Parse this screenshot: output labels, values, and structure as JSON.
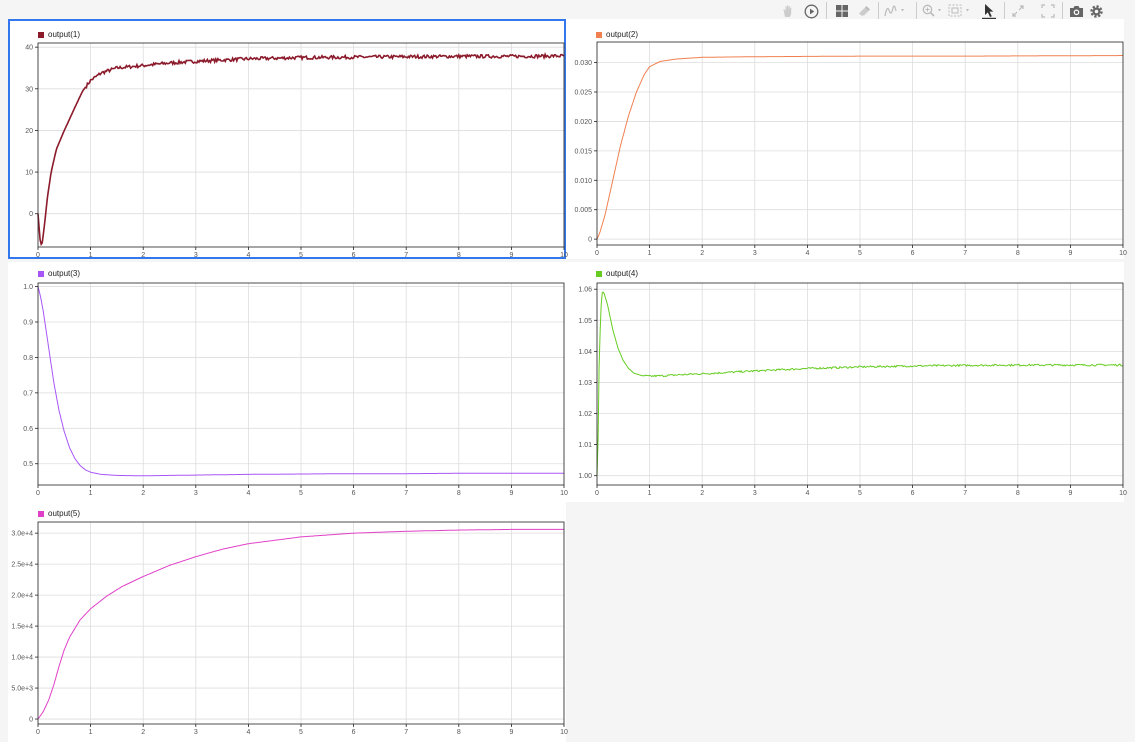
{
  "toolbar": {
    "icons": [
      {
        "name": "pan-hand-icon",
        "enabled": false
      },
      {
        "name": "play-circle-icon",
        "enabled": true
      },
      {
        "name": "layout-grid-icon",
        "enabled": true
      },
      {
        "name": "eraser-icon",
        "enabled": false
      },
      {
        "name": "signal-cursor-icon",
        "enabled": false
      },
      {
        "name": "zoom-in-icon",
        "enabled": false
      },
      {
        "name": "zoom-box-icon",
        "enabled": false
      },
      {
        "name": "pointer-select-icon",
        "enabled": true
      },
      {
        "name": "expand-arrows-icon",
        "enabled": false
      },
      {
        "name": "fullscreen-icon",
        "enabled": false
      },
      {
        "name": "camera-icon",
        "enabled": true
      },
      {
        "name": "gear-icon",
        "enabled": true
      }
    ]
  },
  "colors": {
    "selection_border": "#3377ee",
    "grid": "#dddddd",
    "axis_frame": "#222222"
  },
  "chart_data": [
    {
      "type": "line",
      "title": "",
      "selected": true,
      "series": [
        {
          "name": "output(1)",
          "color": "#8b1a2b",
          "noise": 0.4,
          "points": [
            [
              0,
              0
            ],
            [
              0.03,
              -5
            ],
            [
              0.05,
              -7.5
            ],
            [
              0.08,
              -7
            ],
            [
              0.12,
              -3
            ],
            [
              0.18,
              4
            ],
            [
              0.25,
              10
            ],
            [
              0.35,
              15.5
            ],
            [
              0.5,
              20
            ],
            [
              0.7,
              25.5
            ],
            [
              0.85,
              29.5
            ],
            [
              1.0,
              32
            ],
            [
              1.2,
              33.8
            ],
            [
              1.5,
              35
            ],
            [
              2,
              35.6
            ],
            [
              2.5,
              36.2
            ],
            [
              3,
              36.6
            ],
            [
              4,
              37.2
            ],
            [
              5,
              37.5
            ],
            [
              6,
              37.6
            ],
            [
              7,
              37.7
            ],
            [
              8,
              37.8
            ],
            [
              9,
              37.8
            ],
            [
              10,
              37.9
            ]
          ]
        }
      ],
      "x_ticks": [
        "0",
        "1",
        "2",
        "3",
        "4",
        "5",
        "6",
        "7",
        "8",
        "9",
        "10"
      ],
      "y_ticks": [
        {
          "v": 0,
          "label": "0"
        },
        {
          "v": 10,
          "label": "10"
        },
        {
          "v": 20,
          "label": "20"
        },
        {
          "v": 30,
          "label": "30"
        },
        {
          "v": 40,
          "label": "40"
        }
      ],
      "xlim": [
        0,
        10
      ],
      "ylim": [
        -8,
        41
      ],
      "grid": true
    },
    {
      "type": "line",
      "title": "",
      "selected": false,
      "series": [
        {
          "name": "output(2)",
          "color": "#f08050",
          "noise": 0,
          "points": [
            [
              0,
              0
            ],
            [
              0.05,
              0.001
            ],
            [
              0.15,
              0.004
            ],
            [
              0.3,
              0.01
            ],
            [
              0.45,
              0.016
            ],
            [
              0.6,
              0.021
            ],
            [
              0.75,
              0.025
            ],
            [
              0.9,
              0.028
            ],
            [
              1.0,
              0.0293
            ],
            [
              1.2,
              0.0302
            ],
            [
              1.5,
              0.0306
            ],
            [
              2,
              0.0309
            ],
            [
              3,
              0.031
            ],
            [
              5,
              0.0311
            ],
            [
              7,
              0.0311
            ],
            [
              10,
              0.0312
            ]
          ]
        }
      ],
      "x_ticks": [
        "0",
        "1",
        "2",
        "3",
        "4",
        "5",
        "6",
        "7",
        "8",
        "9",
        "10"
      ],
      "y_ticks": [
        {
          "v": 0,
          "label": "0"
        },
        {
          "v": 0.005,
          "label": "0.005"
        },
        {
          "v": 0.01,
          "label": "0.010"
        },
        {
          "v": 0.015,
          "label": "0.015"
        },
        {
          "v": 0.02,
          "label": "0.020"
        },
        {
          "v": 0.025,
          "label": "0.025"
        },
        {
          "v": 0.03,
          "label": "0.030"
        }
      ],
      "xlim": [
        0,
        10
      ],
      "ylim": [
        -0.001,
        0.0335
      ],
      "grid": true
    },
    {
      "type": "line",
      "title": "",
      "selected": false,
      "series": [
        {
          "name": "output(3)",
          "color": "#a855f7",
          "noise": 0,
          "points": [
            [
              0,
              1.0
            ],
            [
              0.05,
              0.97
            ],
            [
              0.1,
              0.93
            ],
            [
              0.2,
              0.83
            ],
            [
              0.3,
              0.73
            ],
            [
              0.4,
              0.65
            ],
            [
              0.5,
              0.59
            ],
            [
              0.6,
              0.545
            ],
            [
              0.7,
              0.515
            ],
            [
              0.8,
              0.495
            ],
            [
              0.9,
              0.483
            ],
            [
              1.0,
              0.476
            ],
            [
              1.2,
              0.47
            ],
            [
              1.5,
              0.467
            ],
            [
              2,
              0.466
            ],
            [
              3,
              0.468
            ],
            [
              4,
              0.47
            ],
            [
              5,
              0.471
            ],
            [
              6,
              0.472
            ],
            [
              7,
              0.472
            ],
            [
              8,
              0.473
            ],
            [
              10,
              0.473
            ]
          ]
        }
      ],
      "x_ticks": [
        "0",
        "1",
        "2",
        "3",
        "4",
        "5",
        "6",
        "7",
        "8",
        "9",
        "10"
      ],
      "y_ticks": [
        {
          "v": 0.5,
          "label": "0.5"
        },
        {
          "v": 0.6,
          "label": "0.6"
        },
        {
          "v": 0.7,
          "label": "0.7"
        },
        {
          "v": 0.8,
          "label": "0.8"
        },
        {
          "v": 0.9,
          "label": "0.9"
        },
        {
          "v": 1.0,
          "label": "1.0"
        }
      ],
      "xlim": [
        0,
        10
      ],
      "ylim": [
        0.44,
        1.01
      ],
      "grid": true
    },
    {
      "type": "line",
      "title": "",
      "selected": false,
      "series": [
        {
          "name": "output(4)",
          "color": "#66cc22",
          "noise": 0.0003,
          "points": [
            [
              0,
              1.0
            ],
            [
              0.02,
              1.012
            ],
            [
              0.04,
              1.035
            ],
            [
              0.07,
              1.053
            ],
            [
              0.1,
              1.059
            ],
            [
              0.13,
              1.059
            ],
            [
              0.2,
              1.055
            ],
            [
              0.3,
              1.047
            ],
            [
              0.4,
              1.041
            ],
            [
              0.5,
              1.037
            ],
            [
              0.6,
              1.0345
            ],
            [
              0.7,
              1.033
            ],
            [
              0.85,
              1.0322
            ],
            [
              1.0,
              1.032
            ],
            [
              1.3,
              1.0322
            ],
            [
              1.6,
              1.0325
            ],
            [
              2,
              1.0328
            ],
            [
              3,
              1.0337
            ],
            [
              4,
              1.0345
            ],
            [
              5,
              1.035
            ],
            [
              6,
              1.0353
            ],
            [
              7,
              1.0355
            ],
            [
              8,
              1.0356
            ],
            [
              10,
              1.0356
            ]
          ]
        }
      ],
      "x_ticks": [
        "0",
        "1",
        "2",
        "3",
        "4",
        "5",
        "6",
        "7",
        "8",
        "9",
        "10"
      ],
      "y_ticks": [
        {
          "v": 1.0,
          "label": "1.00"
        },
        {
          "v": 1.01,
          "label": "1.01"
        },
        {
          "v": 1.02,
          "label": "1.02"
        },
        {
          "v": 1.03,
          "label": "1.03"
        },
        {
          "v": 1.04,
          "label": "1.04"
        },
        {
          "v": 1.05,
          "label": "1.05"
        },
        {
          "v": 1.06,
          "label": "1.06"
        }
      ],
      "xlim": [
        0,
        10
      ],
      "ylim": [
        0.997,
        1.062
      ],
      "grid": true
    },
    {
      "type": "line",
      "title": "",
      "selected": false,
      "series": [
        {
          "name": "output(5)",
          "color": "#e040c8",
          "noise": 0,
          "points": [
            [
              0,
              0
            ],
            [
              0.1,
              1200
            ],
            [
              0.2,
              3000
            ],
            [
              0.3,
              5500
            ],
            [
              0.4,
              8500
            ],
            [
              0.5,
              11200
            ],
            [
              0.6,
              13200
            ],
            [
              0.8,
              16000
            ],
            [
              1.0,
              17800
            ],
            [
              1.3,
              19800
            ],
            [
              1.6,
              21400
            ],
            [
              2,
              23000
            ],
            [
              2.5,
              24800
            ],
            [
              3,
              26200
            ],
            [
              3.5,
              27400
            ],
            [
              4,
              28300
            ],
            [
              5,
              29400
            ],
            [
              6,
              30000
            ],
            [
              7,
              30300
            ],
            [
              8,
              30500
            ],
            [
              9,
              30600
            ],
            [
              10,
              30600
            ]
          ]
        }
      ],
      "x_ticks": [
        "0",
        "1",
        "2",
        "3",
        "4",
        "5",
        "6",
        "7",
        "8",
        "9",
        "10"
      ],
      "y_ticks": [
        {
          "v": 0,
          "label": "0"
        },
        {
          "v": 5000,
          "label": "5.0e+3"
        },
        {
          "v": 10000,
          "label": "1.0e+4"
        },
        {
          "v": 15000,
          "label": "1.5e+4"
        },
        {
          "v": 20000,
          "label": "2.0e+4"
        },
        {
          "v": 25000,
          "label": "2.5e+4"
        },
        {
          "v": 30000,
          "label": "3.0e+4"
        }
      ],
      "xlim": [
        0,
        10
      ],
      "ylim": [
        -800,
        31800
      ],
      "grid": true
    }
  ]
}
